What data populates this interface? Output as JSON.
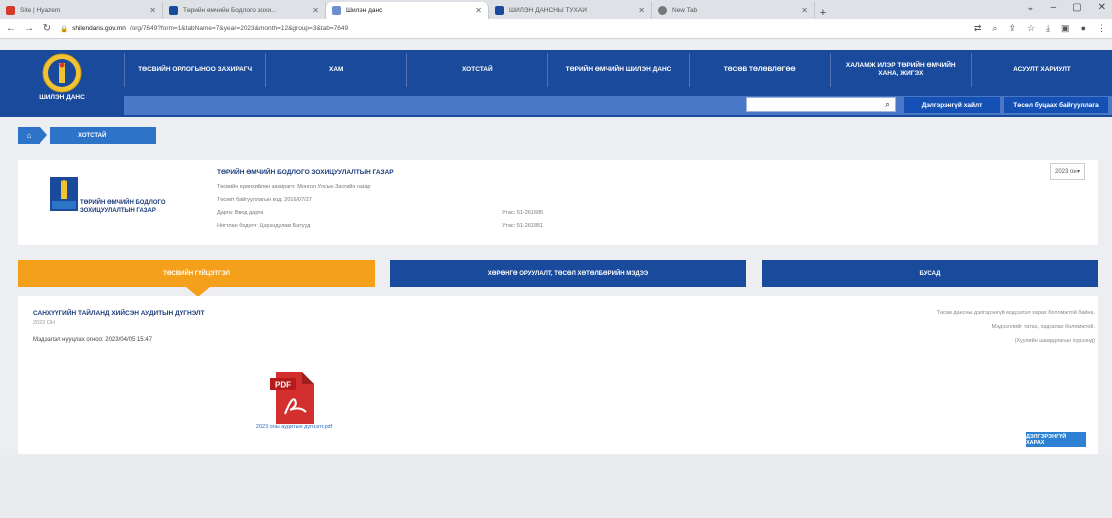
{
  "browser": {
    "tabs": [
      {
        "title": "Site | Hyazem",
        "color": "#d33b2c"
      },
      {
        "title": "Төрийн өмчийн Бодлого зохи...",
        "color": "#1a4a9c"
      },
      {
        "title": "Шилэн данс",
        "color": "#6d8fd1",
        "active": true
      },
      {
        "title": "ШИЛЭН ДАНСНЫ ТУХАЙ",
        "color": "#1a4a9c"
      },
      {
        "title": "New Tab",
        "color": "#777"
      }
    ],
    "url_domain": "shilendans.gov.mn",
    "url_path": "/org/7649?form=1&tabName=7&year=2023&month=12&group=3&tab=7649",
    "window_controls": [
      "⌄",
      "–",
      "▢",
      "✕"
    ]
  },
  "header": {
    "site_name": "ШИЛЭН ДАНС",
    "nav": [
      "ТӨСВИЙН ОРЛОГЫНОО ЗАХИРАГЧ",
      "ХАМ",
      "ХОТСТАЙ",
      "ТӨРИЙН ӨМЧИЙН ШИЛЭН ДАНС",
      "ТӨСӨВ ТӨЛӨВЛӨГӨӨ",
      "ХАЛАМЖ ИЛЭР ТӨРИЙН ӨМЧИЙН ХАНА, ЖИГЭХ",
      "АСУУЛТ ХАРИУЛТ"
    ],
    "search_placeholder": "",
    "btn_login": "Дэлгэрэнгүй хайлт",
    "btn_register": "Төсөл буцаах байгууллага"
  },
  "breadcrumb": {
    "current": "ХОТСТАЙ"
  },
  "org": {
    "name": "ТӨРИЙН ӨМЧИЙН БОДЛОГО ЗОХИЦУУЛАЛТЫН ГАЗАР",
    "title": "ТӨРИЙН ӨМЧИЙН БОДЛОГО ЗОХИЦУУЛАЛТЫН ГАЗАР",
    "rows": [
      {
        "label": "Төсвийн ерөнхийлөн захирагч: Монгол Улсын Засгийн газар",
        "value": ""
      },
      {
        "label": "Төсөвт байгууллагын код: 2016/07/27",
        "value": ""
      },
      {
        "label": "Дарга: Ввод дарга",
        "value": "Утас: 51-261695"
      },
      {
        "label": "Нягтлан бодогч: Цэрэндулам Батууд",
        "value": "Утас: 51-261851"
      }
    ],
    "year": "2023 он"
  },
  "tabs": {
    "tab1": "ТӨСВИЙН ГҮЙЦЭТГЭЛ",
    "tab2": "ХӨРӨНГӨ ОРУУЛАЛТ, ТӨСӨЛ ХӨТӨЛБӨРИЙН МЭДЭЭ",
    "tab3": "БУСАД",
    "active_color": "#f5a01a",
    "inactive_color": "#1a4a9c"
  },
  "document": {
    "title": "САНХҮҮГИЙН ТАЙЛАНД ХИЙСЭН АУДИТЫН ДҮГНЭЛТ",
    "year": "2023 ОН",
    "published": "Мэдээлэл нууцлах огноо: 2023/04/05 15:47",
    "notes": [
      "Төсөв дансны дэлгэрэнгүй мэдээлэл харах боломжтой байна.",
      "Мэдээллийг татах, хадгалах боломжтой.",
      "(Хуулийн шаардлагын хүрээнд)"
    ],
    "file_label": "2023 оны аудитын дүгнэлт.pdf",
    "file_icon": "pdf-icon",
    "detail_button": "ДЭЛГЭРЭНГҮЙ ХАРАХ"
  }
}
